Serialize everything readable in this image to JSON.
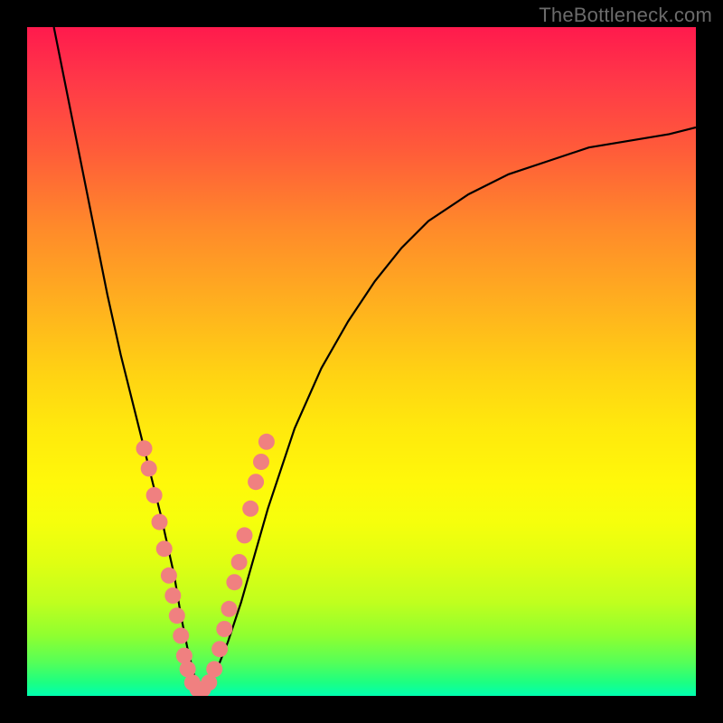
{
  "watermark": {
    "text": "TheBottleneck.com"
  },
  "chart_data": {
    "type": "line",
    "title": "",
    "xlabel": "",
    "ylabel": "",
    "xlim": [
      0,
      100
    ],
    "ylim": [
      0,
      100
    ],
    "grid": false,
    "legend": false,
    "background_gradient": "rainbow-vertical (red top → green bottom)",
    "series": [
      {
        "name": "bottleneck-curve",
        "stroke": "#000000",
        "x": [
          4,
          6,
          8,
          10,
          12,
          14,
          16,
          18,
          20,
          22,
          23,
          24,
          25,
          26,
          27,
          28,
          30,
          32,
          34,
          36,
          38,
          40,
          44,
          48,
          52,
          56,
          60,
          66,
          72,
          78,
          84,
          90,
          96,
          100
        ],
        "y": [
          100,
          90,
          80,
          70,
          60,
          51,
          43,
          35,
          27,
          18,
          12,
          7,
          3,
          1,
          1,
          3,
          8,
          14,
          21,
          28,
          34,
          40,
          49,
          56,
          62,
          67,
          71,
          75,
          78,
          80,
          82,
          83,
          84,
          85
        ]
      }
    ],
    "annotations": [
      {
        "name": "dot-cluster",
        "shape": "circle",
        "fill": "#f08080",
        "radius_px": 9,
        "points": [
          {
            "x": 17.5,
            "y": 37
          },
          {
            "x": 18.2,
            "y": 34
          },
          {
            "x": 19.0,
            "y": 30
          },
          {
            "x": 19.8,
            "y": 26
          },
          {
            "x": 20.5,
            "y": 22
          },
          {
            "x": 21.2,
            "y": 18
          },
          {
            "x": 21.8,
            "y": 15
          },
          {
            "x": 22.4,
            "y": 12
          },
          {
            "x": 23.0,
            "y": 9
          },
          {
            "x": 23.5,
            "y": 6
          },
          {
            "x": 24.0,
            "y": 4
          },
          {
            "x": 24.7,
            "y": 2
          },
          {
            "x": 25.5,
            "y": 1
          },
          {
            "x": 26.3,
            "y": 1
          },
          {
            "x": 27.2,
            "y": 2
          },
          {
            "x": 28.0,
            "y": 4
          },
          {
            "x": 28.8,
            "y": 7
          },
          {
            "x": 29.5,
            "y": 10
          },
          {
            "x": 30.2,
            "y": 13
          },
          {
            "x": 31.0,
            "y": 17
          },
          {
            "x": 31.7,
            "y": 20
          },
          {
            "x": 32.5,
            "y": 24
          },
          {
            "x": 33.4,
            "y": 28
          },
          {
            "x": 34.2,
            "y": 32
          },
          {
            "x": 35.0,
            "y": 35
          },
          {
            "x": 35.8,
            "y": 38
          }
        ]
      }
    ]
  }
}
